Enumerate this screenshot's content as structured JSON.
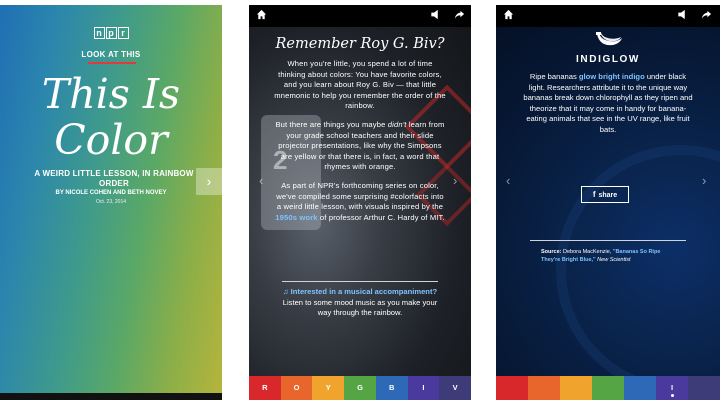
{
  "cover": {
    "logo_letters": [
      "n",
      "p",
      "r"
    ],
    "kicker": "LOOK AT THIS",
    "title_line1": "This Is",
    "title_line2": "Color",
    "subtitle": "A WEIRD LITTLE LESSON, IN RAINBOW ORDER",
    "byline": "BY NICOLE COHEN AND BETH NOVEY",
    "date": "Oct. 23, 2014",
    "next_icon": "chevron-right-icon"
  },
  "roy": {
    "title": "Remember Roy G. Biv?",
    "para1": "When you're little, you spend a lot of time thinking about colors: You have favorite colors, and you learn about Roy G. Biv — that little mnemonic to help you remember the order of the rainbow.",
    "para2_a": "But there are things you maybe ",
    "para2_em": "didn't",
    "para2_b": " learn from your grade school teachers and their slide projector presentations, like why the Simpsons are yellow or that there is, in fact, a word that rhymes with orange.",
    "para3_a": "As part of NPR's forthcoming series on color, we've compiled some surprising #colorfacts into a weird little lesson, with visuals inspired by the ",
    "para3_link": "1950s work",
    "para3_b": " of professor Arthur C. Hardy of MIT.",
    "jersey_number": "2",
    "music_link": "♫ Interested in a musical accompaniment?",
    "music_text": " Listen to some mood music as you make your way through the rainbow."
  },
  "indiglow": {
    "title": "INDIGLOW",
    "body_a": "Ripe bananas ",
    "body_link": "glow bright indigo",
    "body_b": " under black light. Researchers attribute it to the unique way bananas break down chlorophyll as they ripen and theorize that it may come in handy for banana-eating animals that see in the UV range, like fruit bats.",
    "share_label": "share",
    "source_label": "Source:",
    "source_author": " Debora MacKenzie, ",
    "source_link": "\"Bananas So Ripe They're Bright Blue,\"",
    "source_pub": " New Scientist"
  },
  "colorbar": {
    "labels": [
      "R",
      "O",
      "Y",
      "G",
      "B",
      "I",
      "V"
    ],
    "colors": [
      "#d8282c",
      "#e8662c",
      "#f0a42e",
      "#56a545",
      "#2e69b7",
      "#4a3a9d",
      "#3d3b78"
    ]
  },
  "icons": {
    "home": "home-icon",
    "sound": "speaker-icon",
    "share": "share-arrow-icon",
    "prev": "chevron-left-icon",
    "next": "chevron-right-icon",
    "banana": "banana-icon",
    "facebook": "facebook-icon"
  }
}
